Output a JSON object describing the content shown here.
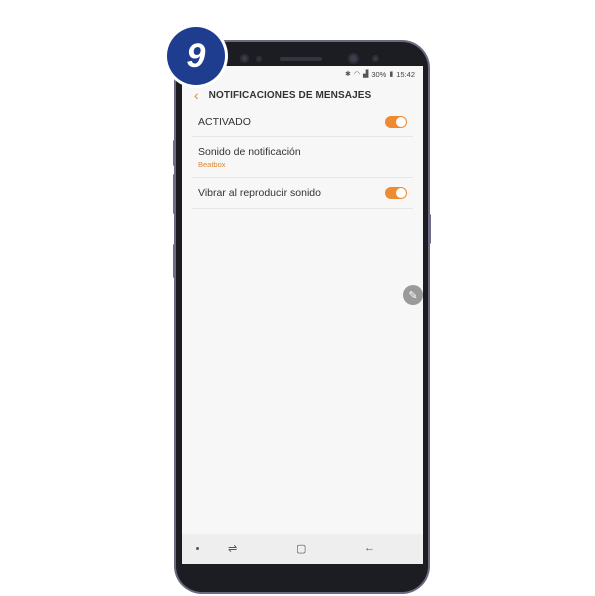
{
  "step_badge": "9",
  "status_bar": {
    "icons": [
      "bluetooth-icon",
      "wifi-icon",
      "signal-icon"
    ],
    "battery": "30%",
    "battery_icon": "battery-icon",
    "time": "15:42"
  },
  "app_bar": {
    "back_icon": "back-arrow-icon",
    "title": "NOTIFICACIONES DE MENSAJES"
  },
  "settings": {
    "activado": {
      "label": "ACTIVADO",
      "toggle_on": true
    },
    "sonido": {
      "label": "Sonido de notificación",
      "value": "Beatbox"
    },
    "vibrar": {
      "label": "Vibrar al reproducir sonido",
      "toggle_on": true
    }
  },
  "nav_bar": {
    "items": [
      "recent-apps-icon",
      "home-icon",
      "back-icon"
    ]
  },
  "colors": {
    "accent": "#ee8a31",
    "badge": "#1e3d8f",
    "screen_bg": "#f7f7f7"
  }
}
